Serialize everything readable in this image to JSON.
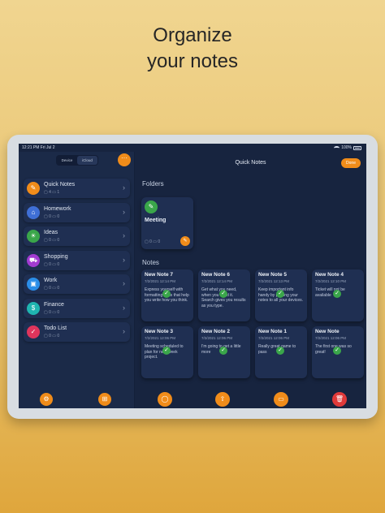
{
  "headline": [
    "Organize",
    "your notes"
  ],
  "status": {
    "time": "12:21 PM   Fri Jul 2",
    "battery": "100%"
  },
  "sidebar": {
    "segments": [
      "Device",
      "iCloud"
    ],
    "more_label": "···",
    "folders": [
      {
        "name": "Quick Notes",
        "meta": "▢ 4   ▭ 1",
        "color": "#f08c1a",
        "icon": "pencil-icon",
        "glyph": "✎"
      },
      {
        "name": "Homework",
        "meta": "▢ 0   ▭ 0",
        "color": "#3f6fd6",
        "icon": "house-icon",
        "glyph": "⌂"
      },
      {
        "name": "Ideas",
        "meta": "▢ 0   ▭ 0",
        "color": "#3aa64a",
        "icon": "lightbulb-icon",
        "glyph": "☀"
      },
      {
        "name": "Shopping",
        "meta": "▢ 0   ▭ 0",
        "color": "#a23bd1",
        "icon": "cart-icon",
        "glyph": "⛟"
      },
      {
        "name": "Work",
        "meta": "▢ 0   ▭ 0",
        "color": "#2b8ee8",
        "icon": "briefcase-icon",
        "glyph": "▣"
      },
      {
        "name": "Finance",
        "meta": "▢ 0   ▭ 0",
        "color": "#1fb5b0",
        "icon": "money-icon",
        "glyph": "$"
      },
      {
        "name": "Todo List",
        "meta": "▢ 0   ▭ 0",
        "color": "#e0355c",
        "icon": "checklist-icon",
        "glyph": "✓"
      }
    ],
    "bottom_buttons": [
      {
        "icon": "settings-icon",
        "glyph": "⚙"
      },
      {
        "icon": "new-folder-icon",
        "glyph": "⊞"
      }
    ]
  },
  "main": {
    "title": "Quick Notes",
    "done_label": "Done",
    "folders_label": "Folders",
    "folder_card": {
      "name": "Meeting",
      "meta": "▢ 0   ▭ 0",
      "icon": "pencil-icon",
      "glyph": "✎"
    },
    "notes_label": "Notes",
    "notes": [
      {
        "title": "New Note 7",
        "date": "7/2/2021 12:14 PM",
        "body": "Express yourself with formatting tools that help you write how you think."
      },
      {
        "title": "New Note 6",
        "date": "7/2/2021 12:14 PM",
        "body": "Get what you need, when you need it. Search gives you results as you type."
      },
      {
        "title": "New Note 5",
        "date": "7/2/2021 12:13 PM",
        "body": "Keep important info handy by pinning your notes to all your devices."
      },
      {
        "title": "New Note 4",
        "date": "7/2/2021 12:10 PM",
        "body": "Ticket will not be available"
      },
      {
        "title": "New Note 3",
        "date": "7/2/2021 12:06 PM",
        "body": "Meeting scheduled to plan for next week project."
      },
      {
        "title": "New Note 2",
        "date": "7/2/2021 12:06 PM",
        "body": "I'm going to get a little more"
      },
      {
        "title": "New Note 1",
        "date": "7/2/2021 12:06 PM",
        "body": "Really great game to pass"
      },
      {
        "title": "New Note",
        "date": "7/2/2021 12:06 PM",
        "body": "The first one was so great!"
      }
    ],
    "bottom_buttons": [
      {
        "icon": "select-icon",
        "glyph": "◯",
        "color": "#f08c1a"
      },
      {
        "icon": "share-icon",
        "glyph": "⇧",
        "color": "#f08c1a"
      },
      {
        "icon": "move-folder-icon",
        "glyph": "▭",
        "color": "#f08c1a"
      },
      {
        "icon": "trash-icon",
        "glyph": "🗑",
        "color": "#e03a3a"
      }
    ]
  },
  "colors": {
    "accent": "#f08c1a",
    "bg": "#17243f",
    "card": "#1f2f52"
  }
}
